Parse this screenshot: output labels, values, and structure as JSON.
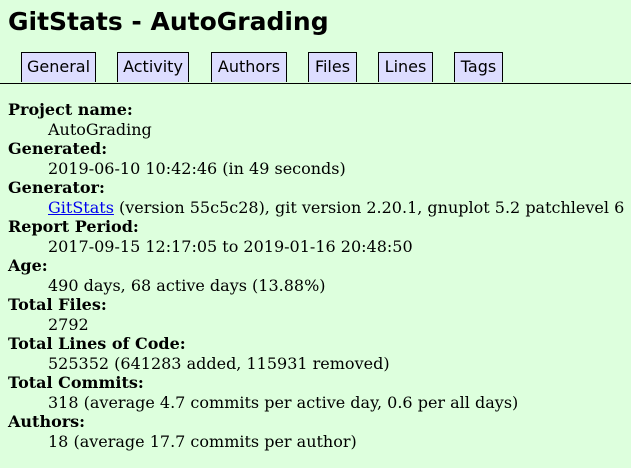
{
  "header": {
    "title": "GitStats - AutoGrading"
  },
  "nav": {
    "tabs": [
      "General",
      "Activity",
      "Authors",
      "Files",
      "Lines",
      "Tags"
    ]
  },
  "general": {
    "project_name_label": "Project name:",
    "project_name": "AutoGrading",
    "generated_label": "Generated:",
    "generated": "2019-06-10 10:42:46 (in 49 seconds)",
    "generator_label": "Generator:",
    "generator_link": "GitStats",
    "generator_rest": " (version 55c5c28), git version 2.20.1, gnuplot 5.2 patchlevel 6",
    "report_period_label": "Report Period:",
    "report_period": "2017-09-15 12:17:05 to 2019-01-16 20:48:50",
    "age_label": "Age:",
    "age": "490 days, 68 active days (13.88%)",
    "total_files_label": "Total Files:",
    "total_files": "2792",
    "total_loc_label": "Total Lines of Code:",
    "total_loc": "525352 (641283 added, 115931 removed)",
    "total_commits_label": "Total Commits:",
    "total_commits": "318 (average 4.7 commits per active day, 0.6 per all days)",
    "authors_label": "Authors:",
    "authors": "18 (average 17.7 commits per author)"
  },
  "colors": {
    "background": "#ddffdd",
    "tab_background": "#ddddff",
    "link": "#0000ee"
  }
}
